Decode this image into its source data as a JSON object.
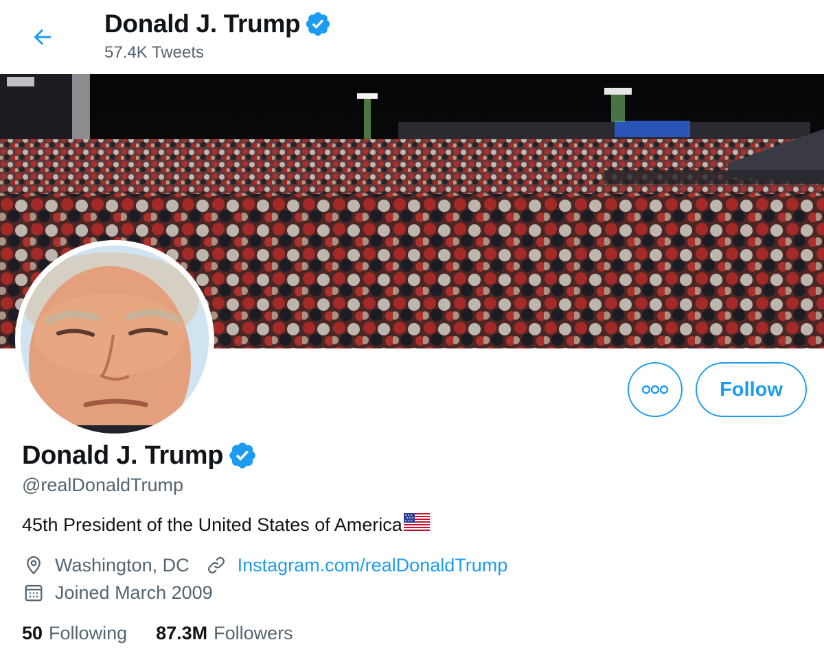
{
  "header": {
    "name": "Donald J. Trump",
    "tweet_count": "57.4K Tweets"
  },
  "profile": {
    "display_name": "Donald J. Trump",
    "handle": "@realDonaldTrump",
    "bio": "45th President of the United States of America",
    "location": "Washington, DC",
    "website": "Instagram.com/realDonaldTrump",
    "joined": "Joined March 2009"
  },
  "actions": {
    "follow_label": "Follow"
  },
  "stats": {
    "following_count": "50",
    "following_label": "Following",
    "followers_count": "87.3M",
    "followers_label": "Followers"
  },
  "icons": {
    "back": "arrow-left-icon",
    "verified": "verified-badge-icon",
    "more": "more-horizontal-icon",
    "location": "location-pin-icon",
    "link": "link-icon",
    "calendar": "calendar-icon"
  },
  "colors": {
    "accent": "#1d9bf0",
    "text_primary": "#0f1419",
    "text_secondary": "#536471"
  }
}
